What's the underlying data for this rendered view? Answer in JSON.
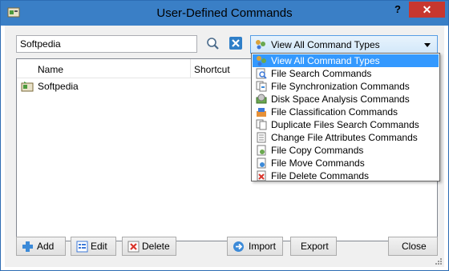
{
  "window": {
    "title": "User-Defined Commands",
    "help_label": "?",
    "close_label": "✕"
  },
  "search": {
    "value": "Softpedia"
  },
  "type_filter": {
    "selected": "View All Command Types",
    "options": [
      "View All Command Types",
      "File Search Commands",
      "File Synchronization Commands",
      "Disk Space Analysis Commands",
      "File Classification Commands",
      "Duplicate Files Search Commands",
      "Change File Attributes Commands",
      "File Copy Commands",
      "File Move Commands",
      "File Delete Commands"
    ],
    "highlight_color": "#3399ff"
  },
  "list": {
    "columns": [
      "Name",
      "Shortcut"
    ],
    "rows": [
      {
        "name": "Softpedia",
        "shortcut": ""
      }
    ]
  },
  "buttons": {
    "add": "Add",
    "edit": "Edit",
    "delete": "Delete",
    "import": "Import",
    "export": "Export",
    "close": "Close"
  },
  "icons": {
    "app": "commands-icon",
    "search": "search-icon",
    "clear": "clear-filter-icon",
    "add": "add-icon",
    "edit": "edit-icon",
    "delete": "delete-icon",
    "import": "import-icon"
  },
  "colors": {
    "titlebar": "#3a7fc6",
    "close_button": "#c7372f"
  }
}
